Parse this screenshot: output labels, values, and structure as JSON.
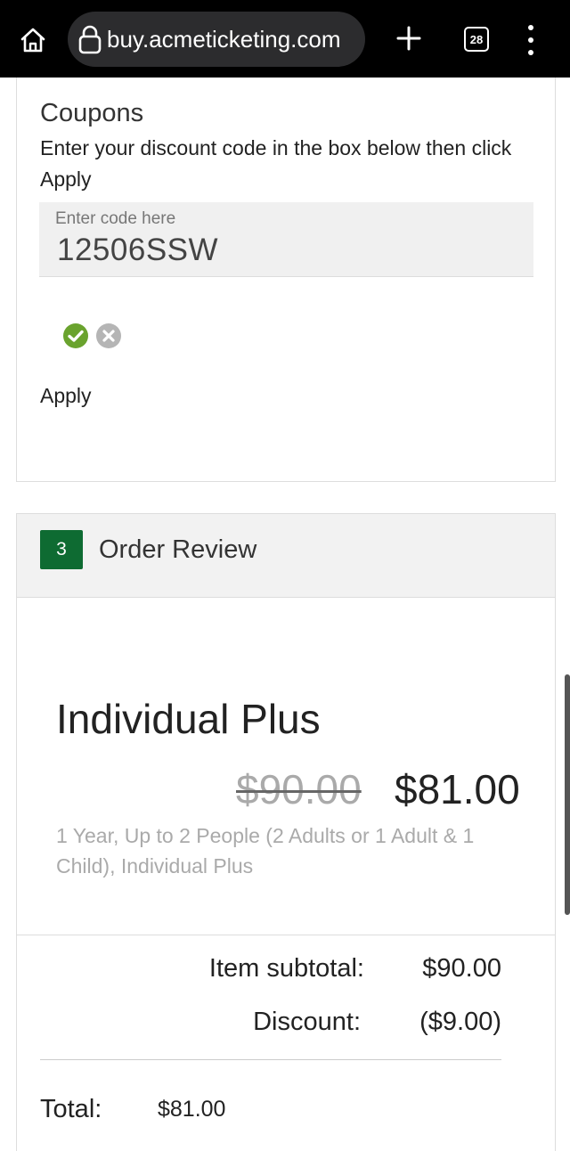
{
  "browser": {
    "url": "buy.acmeticketing.com",
    "tab_count": "28"
  },
  "coupons": {
    "title": "Coupons",
    "description": "Enter your discount code in the box below then click Apply",
    "input_placeholder": "Enter code here",
    "input_value": "12506SSW",
    "apply_label": "Apply"
  },
  "order_review": {
    "step_number": "3",
    "title": "Order Review",
    "product_name": "Individual Plus",
    "original_price": "$90.00",
    "discounted_price": "$81.00",
    "product_description": "1 Year, Up to 2 People (2 Adults or 1 Adult & 1 Child), Individual Plus",
    "subtotal_label": "Item subtotal:",
    "subtotal_value": "$90.00",
    "discount_label": "Discount:",
    "discount_value": "($9.00)",
    "total_label": "Total:",
    "total_value": "$81.00"
  },
  "colors": {
    "accent_green": "#0e6b32",
    "confirm_green": "#6aa32e",
    "cancel_gray": "#b5b5b5"
  },
  "icons": [
    "home-icon",
    "lock-icon",
    "plus-icon",
    "tabs-icon",
    "more-vert-icon",
    "check-circle-icon",
    "x-circle-icon"
  ]
}
